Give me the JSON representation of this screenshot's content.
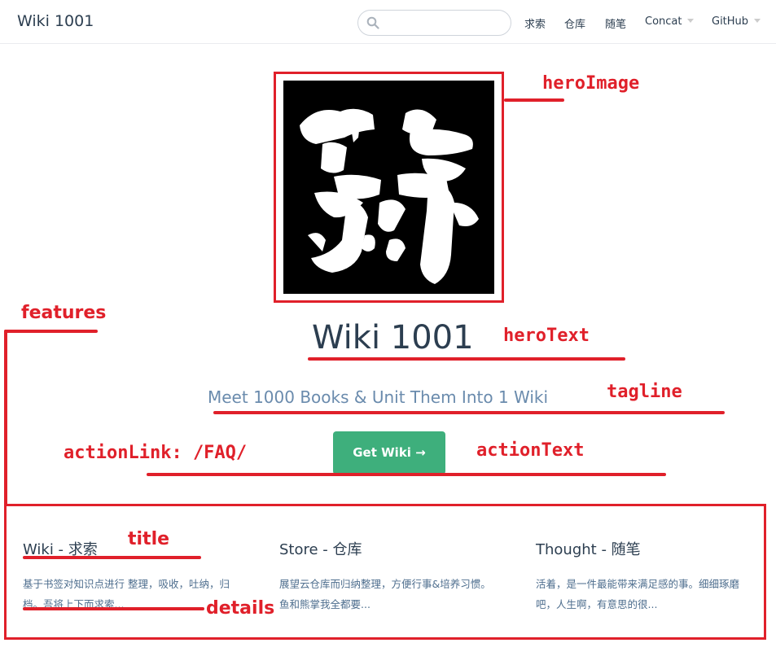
{
  "navbar": {
    "site_name": "Wiki 1001",
    "search_placeholder": "",
    "items": [
      {
        "label": "求索"
      },
      {
        "label": "仓库"
      },
      {
        "label": "随笔"
      },
      {
        "label": "Concat"
      },
      {
        "label": "GitHub"
      }
    ]
  },
  "hero": {
    "image_icon": "calligraphy-logo",
    "hero_text": "Wiki 1001",
    "tagline": "Meet 1000 Books & Unit Them Into 1 Wiki",
    "action_text": "Get Wiki →"
  },
  "features": [
    {
      "title": "Wiki - 求索",
      "details": "基于书签对知识点进行 整理，吸收，吐纳，归档。吾将上下而求索..."
    },
    {
      "title": "Store - 仓库",
      "details": "展望云仓库而归纳整理，方便行事&培养习惯。鱼和熊掌我全都要..."
    },
    {
      "title": "Thought - 随笔",
      "details": "活着，是一件最能带来满足感的事。细细琢磨吧，人生啊，有意思的很..."
    }
  ],
  "annotations": {
    "hero_image": "heroImage",
    "features": "features",
    "hero_text": "heroText",
    "tagline": "tagline",
    "action_link": "actionLink: /FAQ/",
    "action_text": "actionText",
    "title": "title",
    "details": "details",
    "color": "#e0202a"
  },
  "colors": {
    "accent": "#3eaf7c",
    "text": "#2c3e50",
    "tagline": "#6a8bad"
  }
}
